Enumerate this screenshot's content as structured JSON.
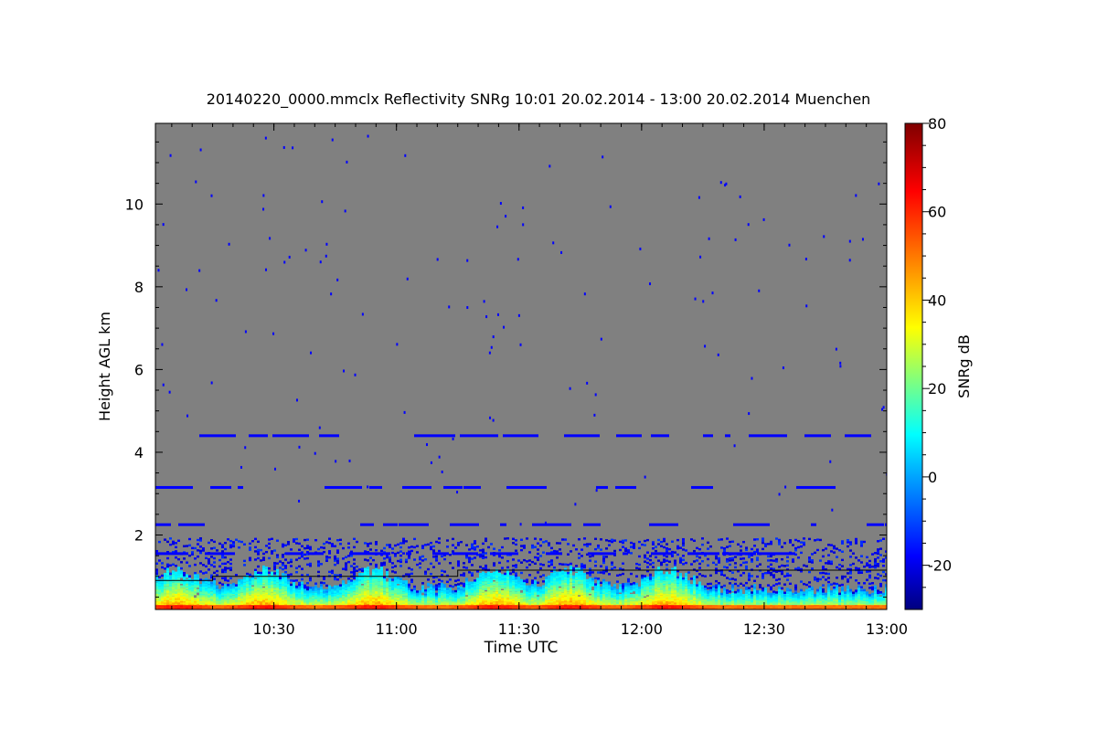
{
  "chart_data": {
    "type": "heatmap",
    "title": "20140220_0000.mmclx Reflectivity SNRg   10:01 20.02.2014 - 13:00 20.02.2014 Muenchen",
    "xlabel": "Time UTC",
    "ylabel": "Height AGL km",
    "colorbar_label": "SNRg dB",
    "xlim_hours": [
      10.0167,
      13.0
    ],
    "ylim_km": [
      0.2,
      11.95
    ],
    "x_ticks": [
      {
        "value": 10.5,
        "label": "10:30"
      },
      {
        "value": 11.0,
        "label": "11:00"
      },
      {
        "value": 11.5,
        "label": "11:30"
      },
      {
        "value": 12.0,
        "label": "12:00"
      },
      {
        "value": 12.5,
        "label": "12:30"
      },
      {
        "value": 13.0,
        "label": "13:00"
      }
    ],
    "y_ticks": [
      {
        "value": 2,
        "label": "2"
      },
      {
        "value": 4,
        "label": "4"
      },
      {
        "value": 6,
        "label": "6"
      },
      {
        "value": 8,
        "label": "8"
      },
      {
        "value": 10,
        "label": "10"
      }
    ],
    "colorbar_range": [
      -30,
      80
    ],
    "colorbar_ticks": [
      {
        "value": -20,
        "label": "-20"
      },
      {
        "value": 0,
        "label": "0"
      },
      {
        "value": 20,
        "label": "20"
      },
      {
        "value": 40,
        "label": "40"
      },
      {
        "value": 60,
        "label": "60"
      },
      {
        "value": 80,
        "label": "80"
      }
    ],
    "colormap": [
      "#00007f",
      "#0000ff",
      "#00bfff",
      "#00ffff",
      "#7fff7f",
      "#ffff00",
      "#ff7f00",
      "#ff0000",
      "#7f0000"
    ],
    "background_color": "#808080",
    "features": {
      "noise_bands_km": [
        4.4,
        3.15,
        2.25,
        1.55
      ],
      "boundary_layer_line": [
        {
          "t": 10.0167,
          "h": 0.9
        },
        {
          "t": 10.25,
          "h": 0.9
        },
        {
          "t": 10.25,
          "h": 1.0
        },
        {
          "t": 11.25,
          "h": 1.0
        },
        {
          "t": 11.25,
          "h": 1.15
        },
        {
          "t": 13.0,
          "h": 1.15
        }
      ],
      "strong_echo_maxima": [
        {
          "t": 10.1,
          "h": 0.45
        },
        {
          "t": 10.45,
          "h": 0.4
        },
        {
          "t": 10.9,
          "h": 0.55
        },
        {
          "t": 11.4,
          "h": 0.5
        },
        {
          "t": 11.7,
          "h": 0.4
        },
        {
          "t": 12.1,
          "h": 0.35
        }
      ]
    }
  }
}
